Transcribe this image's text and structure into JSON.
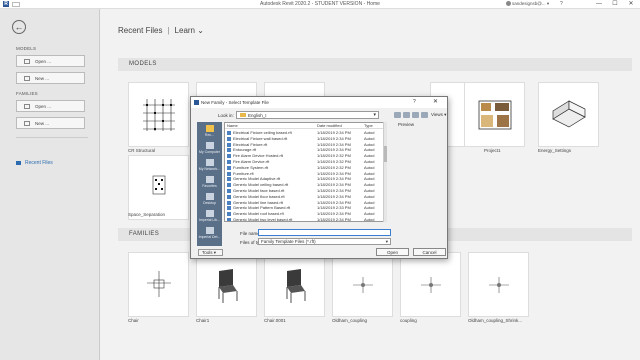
{
  "window": {
    "logo": "R",
    "title": "Autodesk Revit 2020.2 - STUDENT VERSION - Home",
    "user": "sandesignsb@... ▾",
    "help": "?",
    "controls": [
      "—",
      "☐",
      "✕"
    ]
  },
  "sidebar": {
    "back_icon": "back-arrow-icon",
    "models_heading": "MODELS",
    "models_open": "Open ...",
    "models_new": "New ...",
    "families_heading": "FAMILIES",
    "families_open": "Open ...",
    "families_new": "New ...",
    "recent": "Recent Files"
  },
  "header": {
    "breadcrumb": [
      "Recent Files",
      "Learn"
    ],
    "separator": "|",
    "learn_caret": "⌄"
  },
  "models": {
    "heading": "MODELS",
    "tiles": [
      "CR Structural",
      "",
      "",
      "",
      "",
      "Project1",
      "Energy_Settings",
      "Space_Separation"
    ]
  },
  "families": {
    "heading": "FAMILIES",
    "tiles": [
      "Chair",
      "Chair1",
      "Chair.0001",
      "Oldham_coupling",
      "coupling",
      "Oldham_coupling_Shrink..."
    ]
  },
  "dialog": {
    "title": "New Family - Select Template File",
    "help": "?",
    "close": "✕",
    "look_in_label": "Look in:",
    "look_in_value": "English_I",
    "views_label": "Views ▾",
    "places": [
      "Rec...",
      "My Computer",
      "My Network...",
      "Favorites",
      "Desktop",
      "Imperial Lib...",
      "Imperial Det..."
    ],
    "columns": [
      "Name",
      "Date modified",
      "Type"
    ],
    "files": [
      [
        "Electrical Fixture ceiling based.rft",
        "1/18/2019 2:34 PM",
        "Autod"
      ],
      [
        "Electrical Fixture wall based.rft",
        "1/18/2019 2:34 PM",
        "Autod"
      ],
      [
        "Electrical Fixture.rft",
        "1/18/2019 2:34 PM",
        "Autod"
      ],
      [
        "Entourage.rft",
        "1/18/2019 2:34 PM",
        "Autod"
      ],
      [
        "Fire Alarm Device Hosted.rft",
        "1/18/2019 2:32 PM",
        "Autod"
      ],
      [
        "Fire Alarm Device.rft",
        "1/18/2019 2:32 PM",
        "Autod"
      ],
      [
        "Furniture System.rft",
        "1/18/2019 2:32 PM",
        "Autod"
      ],
      [
        "Furniture.rft",
        "1/18/2019 2:34 PM",
        "Autod"
      ],
      [
        "Generic Model Adaptive.rft",
        "1/18/2019 2:34 PM",
        "Autod"
      ],
      [
        "Generic Model ceiling based.rft",
        "1/18/2019 2:34 PM",
        "Autod"
      ],
      [
        "Generic Model face based.rft",
        "1/18/2019 2:34 PM",
        "Autod"
      ],
      [
        "Generic Model floor based.rft",
        "1/18/2019 2:34 PM",
        "Autod"
      ],
      [
        "Generic Model line based.rft",
        "1/18/2019 2:34 PM",
        "Autod"
      ],
      [
        "Generic Model Pattern Based.rft",
        "1/18/2019 2:33 PM",
        "Autod"
      ],
      [
        "Generic Model roof based.rft",
        "1/18/2019 2:34 PM",
        "Autod"
      ],
      [
        "Generic Model two level based.rft",
        "1/18/2019 2:34 PM",
        "Autod"
      ]
    ],
    "preview_label": "Preview",
    "file_name_label": "File name:",
    "file_name_value": "",
    "file_type_label": "Files of type:",
    "file_type_value": "Family Template Files (*.rft)",
    "tools_label": "Tools ▾",
    "open_label": "Open",
    "cancel_label": "Cancel"
  }
}
